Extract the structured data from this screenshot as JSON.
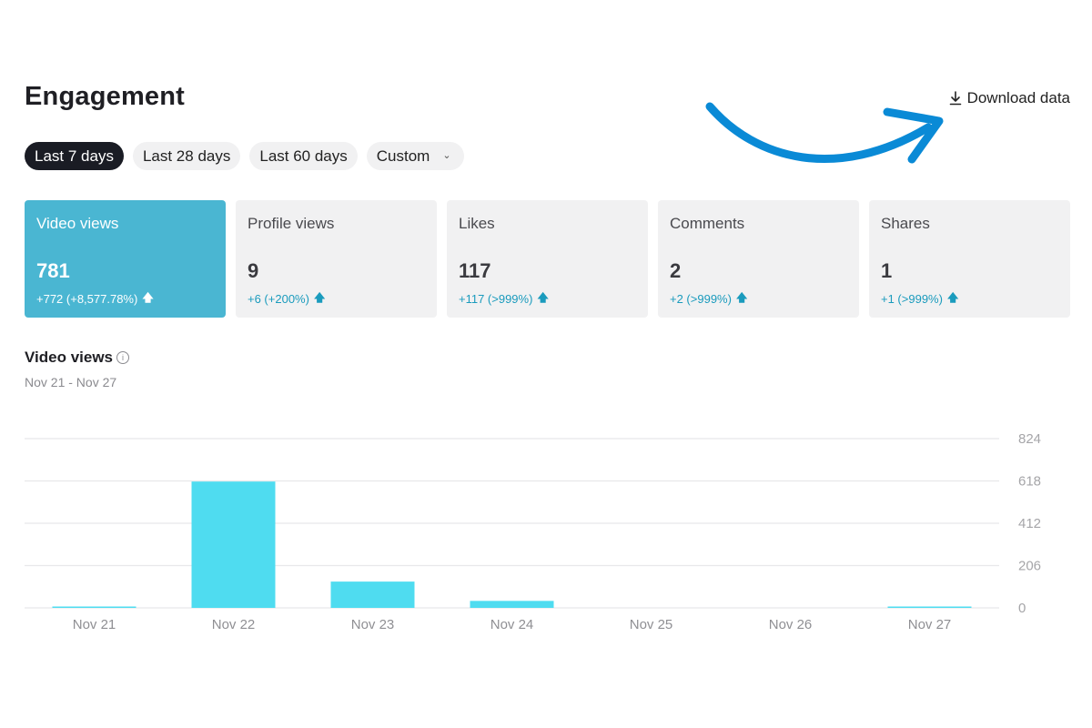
{
  "header": {
    "title": "Engagement",
    "download_label": "Download data",
    "download_icon": "download-icon"
  },
  "annotation": {
    "arrow_color": "#0a8ad6",
    "arrow_icon": "curved-arrow-icon"
  },
  "date_ranges": [
    {
      "label": "Last 7 days",
      "active": true
    },
    {
      "label": "Last 28 days",
      "active": false
    },
    {
      "label": "Last 60 days",
      "active": false
    },
    {
      "label": "Custom",
      "active": false,
      "dropdown": true
    }
  ],
  "metrics": [
    {
      "label": "Video views",
      "value": "781",
      "delta": "+772 (+8,577.78%)",
      "trend": "up",
      "active": true
    },
    {
      "label": "Profile views",
      "value": "9",
      "delta": "+6 (+200%)",
      "trend": "up",
      "active": false
    },
    {
      "label": "Likes",
      "value": "117",
      "delta": "+117 (>999%)",
      "trend": "up",
      "active": false
    },
    {
      "label": "Comments",
      "value": "2",
      "delta": "+2 (>999%)",
      "trend": "up",
      "active": false
    },
    {
      "label": "Shares",
      "value": "1",
      "delta": "+1 (>999%)",
      "trend": "up",
      "active": false
    }
  ],
  "chart_section": {
    "title": "Video views",
    "info_icon": "info-icon",
    "date_range": "Nov 21 - Nov 27"
  },
  "colors": {
    "accent": "#4ab6d2",
    "bar": "#4fdcf0",
    "delta": "#1a9bbd",
    "active_pill": "#1a1c24"
  },
  "chart_data": {
    "type": "bar",
    "title": "Video views",
    "subtitle": "Nov 21 - Nov 27",
    "categories": [
      "Nov 21",
      "Nov 22",
      "Nov 23",
      "Nov 24",
      "Nov 25",
      "Nov 26",
      "Nov 27"
    ],
    "values": [
      3,
      615,
      128,
      34,
      0,
      0,
      1
    ],
    "y_ticks": [
      "0",
      "206",
      "412",
      "618",
      "824"
    ],
    "ylim": [
      0,
      824
    ],
    "xlabel": "",
    "ylabel": "",
    "y_axis_position": "right",
    "grid": true,
    "legend": "none"
  }
}
